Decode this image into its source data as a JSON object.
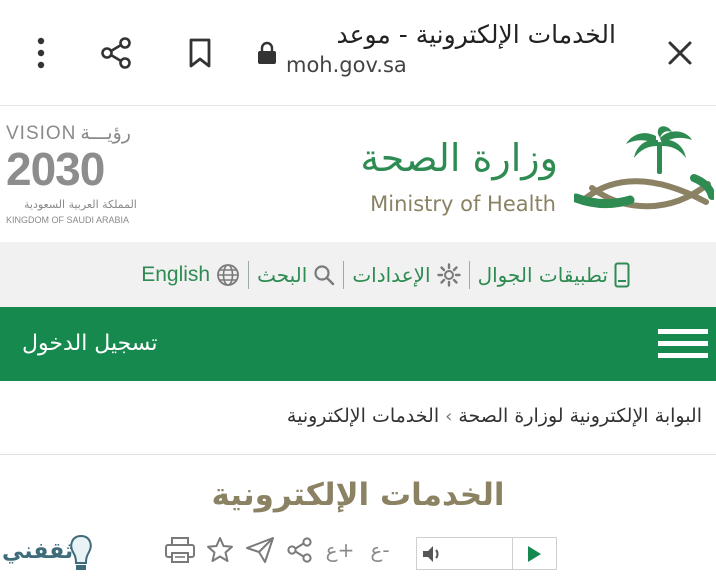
{
  "browser": {
    "title": "الخدمات الإلكترونية - موعد",
    "url": "moh.gov.sa"
  },
  "logos": {
    "vision_label": "VISION",
    "vision_arabic": "رؤيـــة",
    "vision_year": "2030",
    "vision_kingdom_ar": "المملكة العربية السعودية",
    "vision_kingdom_en": "KINGDOM OF SAUDI ARABIA",
    "ministry_ar": "وزارة الصحة",
    "ministry_en": "Ministry of Health"
  },
  "utility_nav": {
    "items": [
      {
        "label": "تطبيقات الجوال",
        "icon": "mobile-icon"
      },
      {
        "label": "الإعدادات",
        "icon": "gear-icon"
      },
      {
        "label": "البحث",
        "icon": "search-icon"
      },
      {
        "label": "English",
        "icon": "globe-icon"
      }
    ]
  },
  "header": {
    "login_label": "تسجيل الدخول",
    "menu_icon": "hamburger-menu-icon"
  },
  "breadcrumb": {
    "items": [
      "البوابة الإلكترونية لوزارة الصحة",
      "الخدمات الإلكترونية"
    ],
    "separator": "›"
  },
  "main": {
    "heading": "الخدمات الإلكترونية"
  },
  "tools": {
    "font_reset": "ع",
    "font_increase": "ع+",
    "font_decrease": "ع-"
  },
  "watermark": {
    "text": "ثقفني"
  },
  "colors": {
    "green": "#16894f",
    "green_text": "#2e8c52",
    "gold": "#8b8264"
  }
}
